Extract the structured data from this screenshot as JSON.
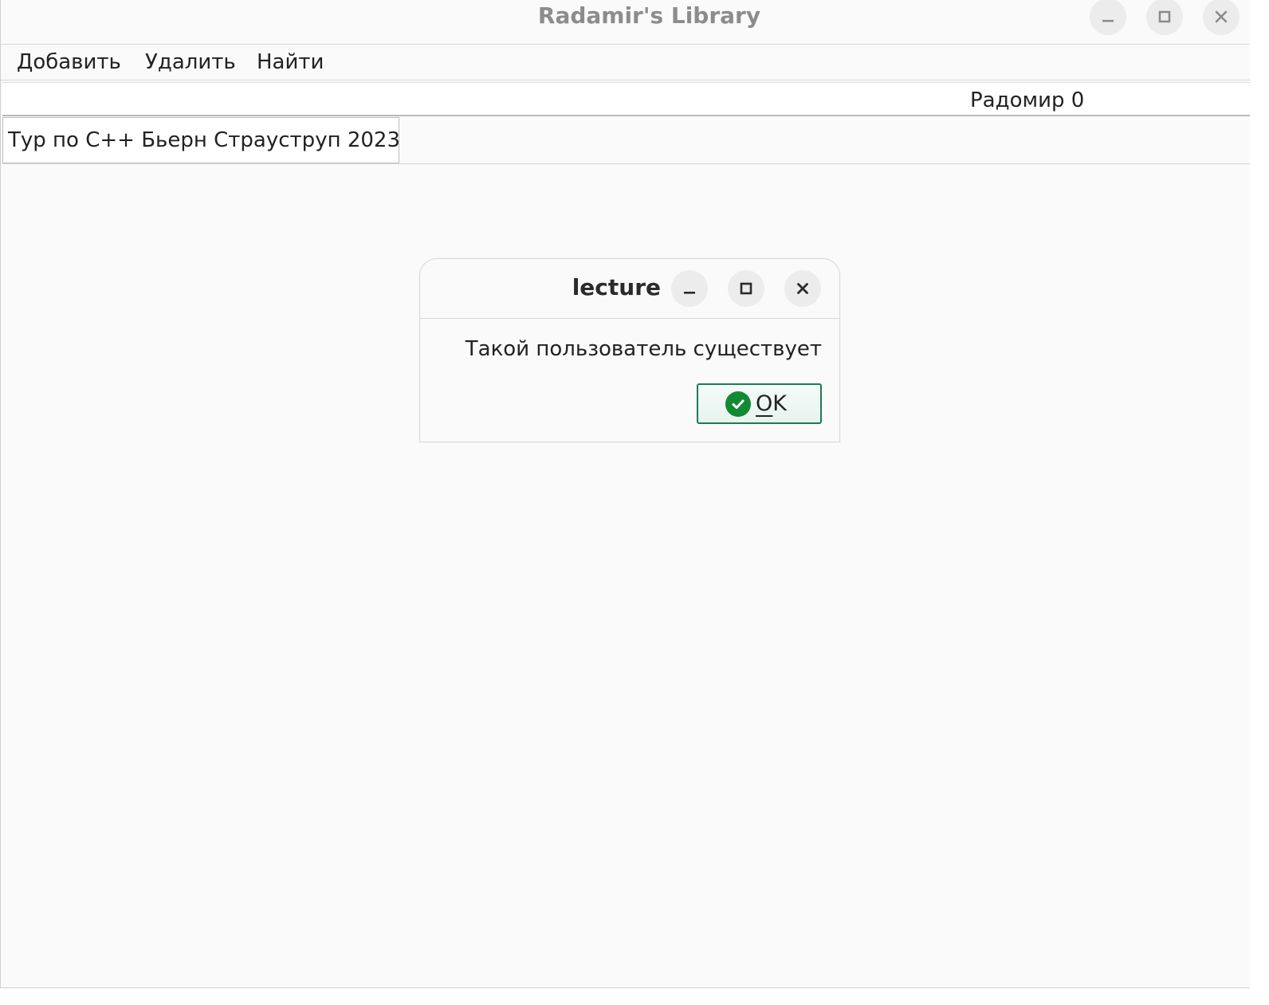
{
  "window": {
    "title": "Radamir's Library"
  },
  "menu": {
    "items": [
      {
        "label": "Добавить"
      },
      {
        "label": "Удалить"
      },
      {
        "label": "Найти"
      }
    ]
  },
  "user": {
    "label": "Радомир 0"
  },
  "books": [
    {
      "label": "Тур по C++ Бьерн Страуструп 2023"
    }
  ],
  "dialog": {
    "title": "lecture",
    "message": "Такой пользователь существует",
    "ok_first": "O",
    "ok_rest": "K"
  },
  "icons": {
    "minimize": "minimize-icon",
    "maximize": "maximize-icon",
    "close": "close-icon",
    "check": "check-circle-icon"
  },
  "colors": {
    "ok_border": "#1e7a55",
    "ok_check": "#128a34",
    "title_text": "#8c8c8c"
  }
}
